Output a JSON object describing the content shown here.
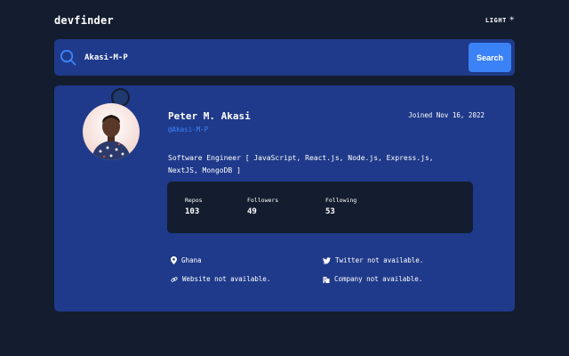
{
  "header": {
    "logo": "devfinder",
    "theme_label": "LIGHT",
    "theme_icon": "sun-icon"
  },
  "search": {
    "value": "Akasi-M-P",
    "button_label": "Search",
    "icon": "search-icon"
  },
  "profile": {
    "name": "Peter M. Akasi",
    "handle": "@Akasi-M-P",
    "joined": "Joined Nov 16, 2022",
    "bio": "Software Engineer [ JavaScript, React.js, Node.js, Express.js, NextJS, MongoDB ]",
    "stats": [
      {
        "label": "Repos",
        "value": "103"
      },
      {
        "label": "Followers",
        "value": "49"
      },
      {
        "label": "Following",
        "value": "53"
      }
    ],
    "links": {
      "location": "Ghana",
      "twitter": "Twitter not available.",
      "website": "Website not available.",
      "company": "Company not available."
    }
  },
  "colors": {
    "background": "#141d2f",
    "card": "#1f3a8a",
    "accent": "#3b82f6",
    "text": "#ffffff"
  }
}
